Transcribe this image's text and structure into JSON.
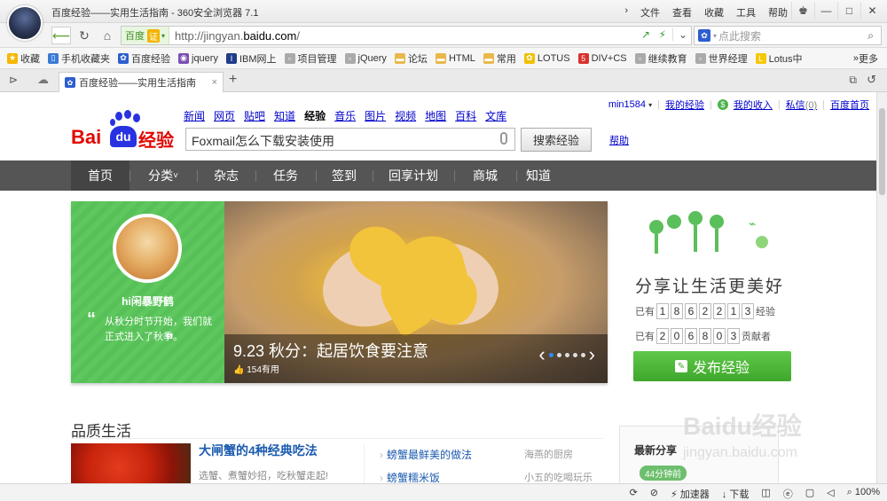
{
  "browser": {
    "title": "百度经验——实用生活指南 - 360安全浏览器 7.1",
    "menus": [
      "文件",
      "查看",
      "收藏",
      "工具",
      "帮助"
    ],
    "window_buttons": [
      "♚",
      "—",
      "□",
      "✕"
    ],
    "address": {
      "badge_text": "百度",
      "badge_cert": "证",
      "url_prefix": "http://jingyan.",
      "url_domain": "baidu.com",
      "url_suffix": "/"
    },
    "search_placeholder": "点此搜索",
    "bookmarks": [
      {
        "label": "收藏",
        "icon": "star-icon",
        "color": "#f5b800"
      },
      {
        "label": "手机收藏夹",
        "icon": "phone-icon",
        "color": "#3a7bd5"
      },
      {
        "label": "百度经验",
        "icon": "paw-icon",
        "color": "#2d5ecf"
      },
      {
        "label": "jquery",
        "icon": "jquery-icon",
        "color": "#7b4fb3"
      },
      {
        "label": "IBM网上",
        "icon": "ibm-icon",
        "color": "#1f3c88"
      },
      {
        "label": "项目管理",
        "icon": "page-icon",
        "color": "#aaaaaa"
      },
      {
        "label": "jQuery",
        "icon": "page-icon",
        "color": "#aaaaaa"
      },
      {
        "label": "论坛",
        "icon": "folder-icon",
        "color": "#e8b84a"
      },
      {
        "label": "HTML",
        "icon": "folder-icon",
        "color": "#e8b84a"
      },
      {
        "label": "常用",
        "icon": "folder-icon",
        "color": "#e8b84a"
      },
      {
        "label": "LOTUS",
        "icon": "lotus-icon",
        "color": "#f0c000"
      },
      {
        "label": "DIV+CS",
        "icon": "div-icon",
        "color": "#d9312c"
      },
      {
        "label": "继续教育",
        "icon": "page-icon",
        "color": "#aaaaaa"
      },
      {
        "label": "世界经理",
        "icon": "page-icon",
        "color": "#aaaaaa"
      },
      {
        "label": "Lotus中",
        "icon": "l-icon",
        "color": "#f6c800"
      }
    ],
    "more_label": "更多",
    "tab_title": "百度经验——实用生活指南",
    "status": {
      "accelerator": "加速器",
      "download": "下载",
      "zoom": "100%"
    }
  },
  "page": {
    "logo": {
      "bai": "Bai",
      "du": "du",
      "jy": "经验"
    },
    "top_links": [
      "新闻",
      "网页",
      "贴吧",
      "知道",
      "经验",
      "音乐",
      "图片",
      "视频",
      "地图",
      "百科",
      "文库"
    ],
    "user_links": {
      "username": "min1584",
      "my_exp": "我的经验",
      "my_income": "我的收入",
      "messages": "私信",
      "message_count": "(0)",
      "home": "百度首页"
    },
    "search_value": "Foxmail怎么下载安装使用",
    "search_button": "搜索经验",
    "help": "帮助",
    "nav": [
      "首页",
      "分类",
      "杂志",
      "任务",
      "签到",
      "回享计划",
      "商城",
      "知道"
    ],
    "hero": {
      "user_name": "hi闲暴野鹤",
      "quote": "从秋分时节开始，我们就正式进入了秋季。",
      "caption": "9.23 秋分：起居饮食要注意",
      "likes": "154有用"
    },
    "share": {
      "slogan": "分享让生活更美好",
      "exp_prefix": "已有",
      "exp_digits": [
        "1",
        "8",
        "6",
        "2",
        "2",
        "1",
        "3"
      ],
      "exp_suffix": "经验",
      "contrib_prefix": "已有",
      "contrib_digits": [
        "2",
        "0",
        "6",
        "8",
        "0",
        "3"
      ],
      "contrib_suffix": "贡献者",
      "publish_button": "发布经验"
    },
    "section": {
      "title": "品质生活",
      "featured_title": "大闸蟹的4种经典吃法",
      "featured_desc": "选蟹、煮蟹妙招，吃秋蟹走起!",
      "list": [
        {
          "title": "螃蟹最鲜美的做法",
          "author": "海燕的厨房"
        },
        {
          "title": "螃蟹糯米饭",
          "author": "小五的吃喝玩乐"
        }
      ]
    },
    "latest": {
      "title": "最新分享",
      "tag": "44分钟前"
    },
    "watermark": {
      "big": "Baidu经验",
      "small": "jingyan.baidu.com"
    }
  }
}
